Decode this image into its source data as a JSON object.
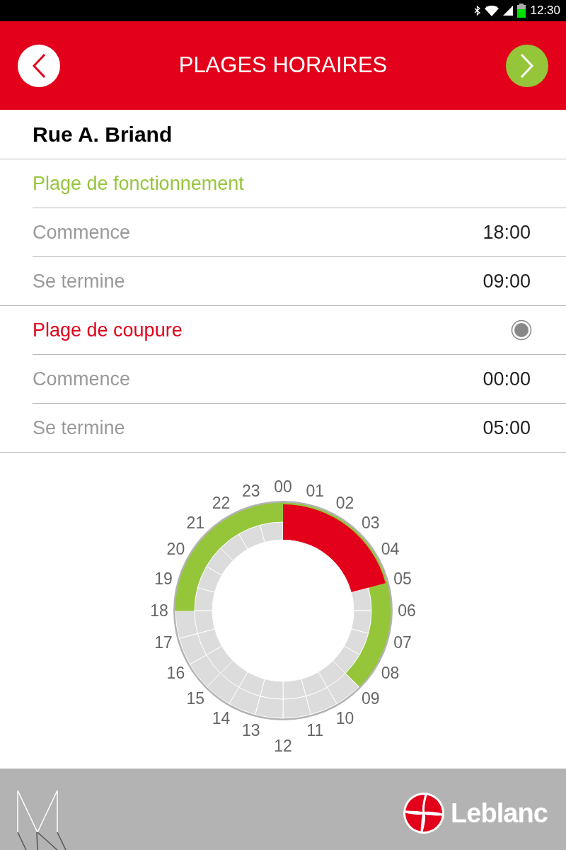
{
  "status_bar": {
    "time": "12:30"
  },
  "header": {
    "title": "PLAGES HORAIRES"
  },
  "site": {
    "name": "Rue A. Briand"
  },
  "sections": [
    {
      "kind": "operating",
      "title": "Plage de fonctionnement",
      "rows": [
        {
          "label": "Commence",
          "value": "18:00"
        },
        {
          "label": "Se termine",
          "value": "09:00"
        }
      ]
    },
    {
      "kind": "cutoff",
      "title": "Plage de coupure",
      "selected": true,
      "rows": [
        {
          "label": "Commence",
          "value": "00:00"
        },
        {
          "label": "Se termine",
          "value": "05:00"
        }
      ]
    }
  ],
  "dial": {
    "right_side_hours": [
      "00",
      "01",
      "02",
      "03",
      "04",
      "05",
      "06",
      "07",
      "08",
      "09",
      "10",
      "11",
      "12"
    ],
    "left_side_hours": [
      "23",
      "22",
      "21",
      "20",
      "19",
      "18",
      "17",
      "16",
      "15",
      "14",
      "13"
    ]
  },
  "footer": {
    "brand": "Leblanc"
  }
}
